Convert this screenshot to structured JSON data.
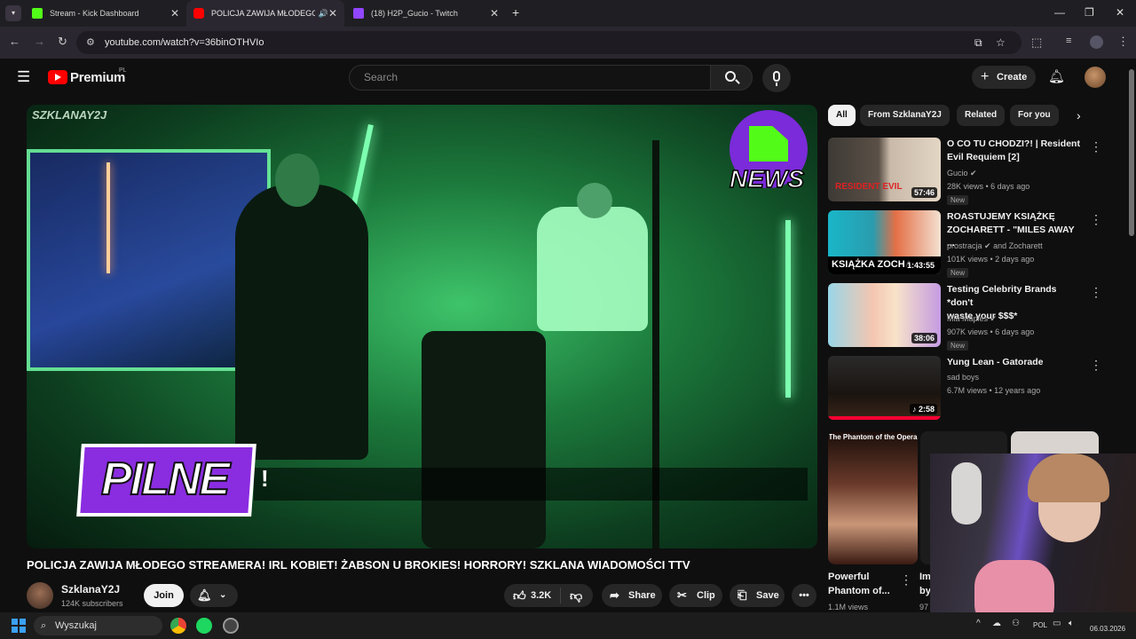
{
  "tabs": [
    {
      "label": "Stream - Kick Dashboard",
      "favicon_color": "#53fc18"
    },
    {
      "label": "POLICJA ZAWIJA MŁODEGO S",
      "favicon_color": "#ff0000"
    },
    {
      "label": "(18) H2P_Gucio - Twitch",
      "favicon_color": "#9146ff"
    }
  ],
  "url": "youtube.com/watch?v=36binOTHVIo",
  "yt": {
    "logo_text": "Premium",
    "region": "PL",
    "search_placeholder": "Search",
    "create_label": "Create"
  },
  "video": {
    "watermark": "SZKLANAY2J",
    "news_badge": "NEWS",
    "banner_text": "PILNE",
    "banner_excl": "!",
    "title": "POLICJA ZAWIJA MŁODEGO STREAMERA! IRL KOBIET! ŻABSON U BROKIES! HORRORY! SZKLANA WIADOMOŚCI TTV"
  },
  "channel": {
    "name": "SzklanaY2J",
    "subscribers": "124K subscribers",
    "join_label": "Join"
  },
  "actions": {
    "likes": "3.2K",
    "share": "Share",
    "clip": "Clip",
    "save": "Save"
  },
  "chips": [
    "All",
    "From SzklanaY2J",
    "Related",
    "For you"
  ],
  "recommendations": [
    {
      "title1": "O CO TU CHODZI?! | Resident",
      "title2": "Evil Requiem [2]",
      "channel": "Gucio",
      "verified": true,
      "views": "28K views • 6 days ago",
      "duration": "57:46",
      "new": "New",
      "thumb_text": "RESIDENT EVIL"
    },
    {
      "title1": "ROASTUJEMY KSIĄŻKĘ",
      "title2": "ZOCHARETT - \"MILES AWAY ...",
      "channel": "prostracja",
      "channel2": "and Zocharett",
      "verified": true,
      "views": "101K views • 2 days ago",
      "duration": "1:43:55",
      "new": "New",
      "thumb_text": "KSIĄŻKA ZOCHA"
    },
    {
      "title1": "Testing Celebrity Brands *don't",
      "title2": "waste your $$$*",
      "channel": "Mia Maples",
      "verified": true,
      "views": "907K views • 6 days ago",
      "duration": "38:06",
      "new": "New"
    },
    {
      "title1": "Yung Lean - Gatorade",
      "title2": "",
      "channel": "sad boys",
      "verified": false,
      "views": "6.7M views • 12 years ago",
      "duration": "2:58"
    }
  ],
  "shorts": [
    {
      "overlay": "The Phantom of the Opera",
      "title1": "Powerful",
      "title2": "Phantom of...",
      "views": "1.1M views"
    },
    {
      "title1": "Im",
      "title2": "by",
      "views": "97"
    }
  ],
  "taskbar": {
    "search": "Wyszukaj",
    "lang": "POL",
    "date": "06.03.2026"
  }
}
